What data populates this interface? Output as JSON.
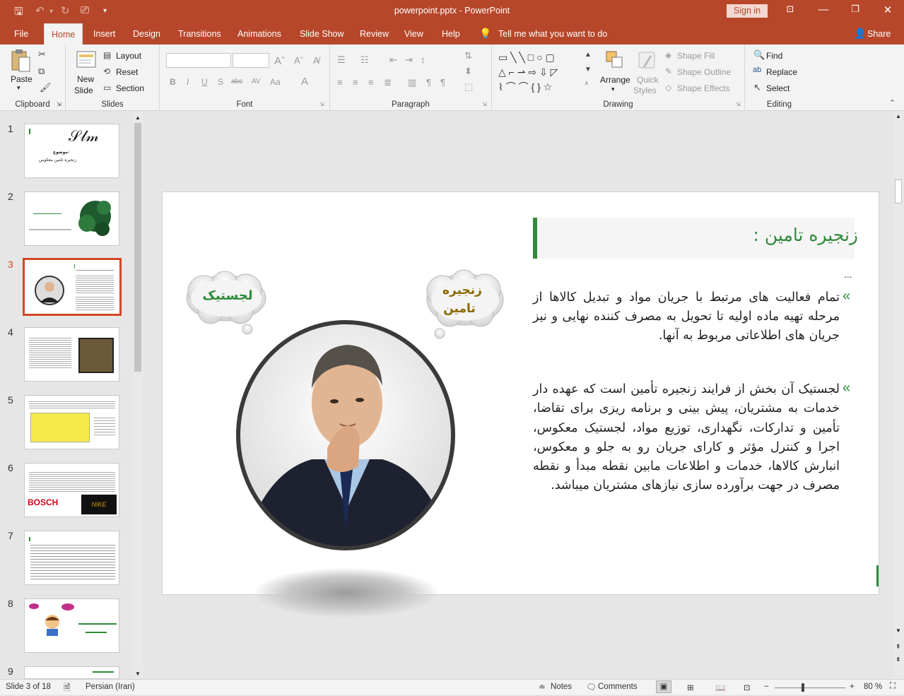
{
  "window": {
    "title": "powerpoint.pptx  -  PowerPoint",
    "sign_in": "Sign in"
  },
  "tabs": [
    "File",
    "Home",
    "Insert",
    "Design",
    "Transitions",
    "Animations",
    "Slide Show",
    "Review",
    "View",
    "Help"
  ],
  "active_tab": "Home",
  "tell_me": "Tell me what you want to do",
  "share": "Share",
  "ribbon": {
    "clipboard": {
      "paste": "Paste",
      "label": "Clipboard"
    },
    "slides": {
      "new_slide_1": "New",
      "new_slide_2": "Slide",
      "layout": "Layout",
      "reset": "Reset",
      "section": "Section",
      "label": "Slides"
    },
    "font": {
      "label": "Font",
      "bold": "B",
      "italic": "I",
      "underline": "U",
      "shadow": "S",
      "strike": "abc",
      "spacing": "AV",
      "case": "Aa",
      "color": "A"
    },
    "paragraph": {
      "label": "Paragraph"
    },
    "drawing": {
      "label": "Drawing",
      "arrange": "Arrange",
      "quick_styles_1": "Quick",
      "quick_styles_2": "Styles",
      "shape_fill": "Shape Fill",
      "shape_outline": "Shape Outline",
      "shape_effects": "Shape Effects"
    },
    "editing": {
      "label": "Editing",
      "find": "Find",
      "replace": "Replace",
      "select": "Select"
    }
  },
  "thumbnails": [
    {
      "num": "1"
    },
    {
      "num": "2"
    },
    {
      "num": "3",
      "selected": true
    },
    {
      "num": "4"
    },
    {
      "num": "5"
    },
    {
      "num": "6"
    },
    {
      "num": "7"
    },
    {
      "num": "8"
    },
    {
      "num": "9"
    }
  ],
  "thumb_text": {
    "t1_line1": "موضوع:",
    "t1_line2": "زنجیره تامین معکوس",
    "t6_logo1": "BOSCH",
    "t6_logo2": "NIKE"
  },
  "slide": {
    "title": "زنجیره تامین :",
    "ellipsis": "...",
    "bullet": "«",
    "paragraph1": "تمام فعالیت های مرتبط با جریان مواد و تبدیل کالاها از مرحله تهیه ماده اولیه تا تحویل به مصرف کننده نهایی و نیز جریان های اطلاعاتی مربوط به آنها.",
    "paragraph2": "لجستیک آن بخش از فرایند زنجیره تأمین است که عهده دار خدمات به مشتریان، پیش بینی و برنامه ریزی برای تقاضا، تأمین و تدارکات، نگهداری، توزیع مواد، لجستیک معکوس، اجرا و کنترل مؤثر و کارای جریان رو به جلو و معکوس، انبارش کالاها، خدمات و اطلاعات مابین نقطه مبدأ و نقطه مصرف در جهت برآورده سازی نیازهای مشتریان میباشد.",
    "cloud_left": "لجستیک",
    "cloud_right_1": "زنجیره",
    "cloud_right_2": "تامین"
  },
  "status": {
    "slide_info": "Slide 3 of 18",
    "language": "Persian (Iran)",
    "notes": "Notes",
    "comments": "Comments",
    "zoom": "80 %"
  },
  "colors": {
    "accent": "#b7472a",
    "slide_green": "#2e8b3a",
    "cloud_text_left": "#2e8b3a",
    "cloud_text_right": "#8a6a00"
  }
}
